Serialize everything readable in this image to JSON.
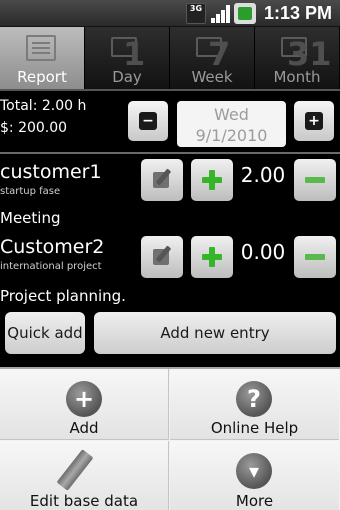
{
  "status_bar": {
    "network_label": "3G",
    "time": "1:13 PM"
  },
  "tabs": [
    {
      "label": "Report",
      "icon": "report-icon",
      "active": true
    },
    {
      "label": "Day",
      "icon": "calendar-day-icon",
      "number": "1",
      "active": false
    },
    {
      "label": "Week",
      "icon": "calendar-week-icon",
      "number": "7",
      "active": false
    },
    {
      "label": "Month",
      "icon": "calendar-month-icon",
      "number": "31",
      "active": false
    }
  ],
  "summary": {
    "total_line": "Total: 2.00 h",
    "money_line": "$: 200.00"
  },
  "date_nav": {
    "prev_glyph": "−",
    "next_glyph": "+",
    "weekday": "Wed",
    "date": "9/1/2010"
  },
  "entries": [
    {
      "customer": "customer1",
      "project": "startup fase",
      "hours": "2.00",
      "task": "Meeting"
    },
    {
      "customer": "Customer2",
      "project": "international project",
      "hours": "0.00",
      "task": "Project planning."
    }
  ],
  "actions": {
    "quick_add": "Quick add",
    "add_new_entry": "Add new entry"
  },
  "menu": [
    {
      "label": "Add",
      "icon": "add-icon",
      "glyph": "+"
    },
    {
      "label": "Online Help",
      "icon": "help-icon",
      "glyph": "?"
    },
    {
      "label": "Edit base data",
      "icon": "pencil-icon",
      "glyph": ""
    },
    {
      "label": "More",
      "icon": "more-icon",
      "glyph": "▾"
    }
  ],
  "colors": {
    "accent_green": "#36b52b",
    "background": "#000000",
    "menu_background": "#f2f2f2"
  }
}
